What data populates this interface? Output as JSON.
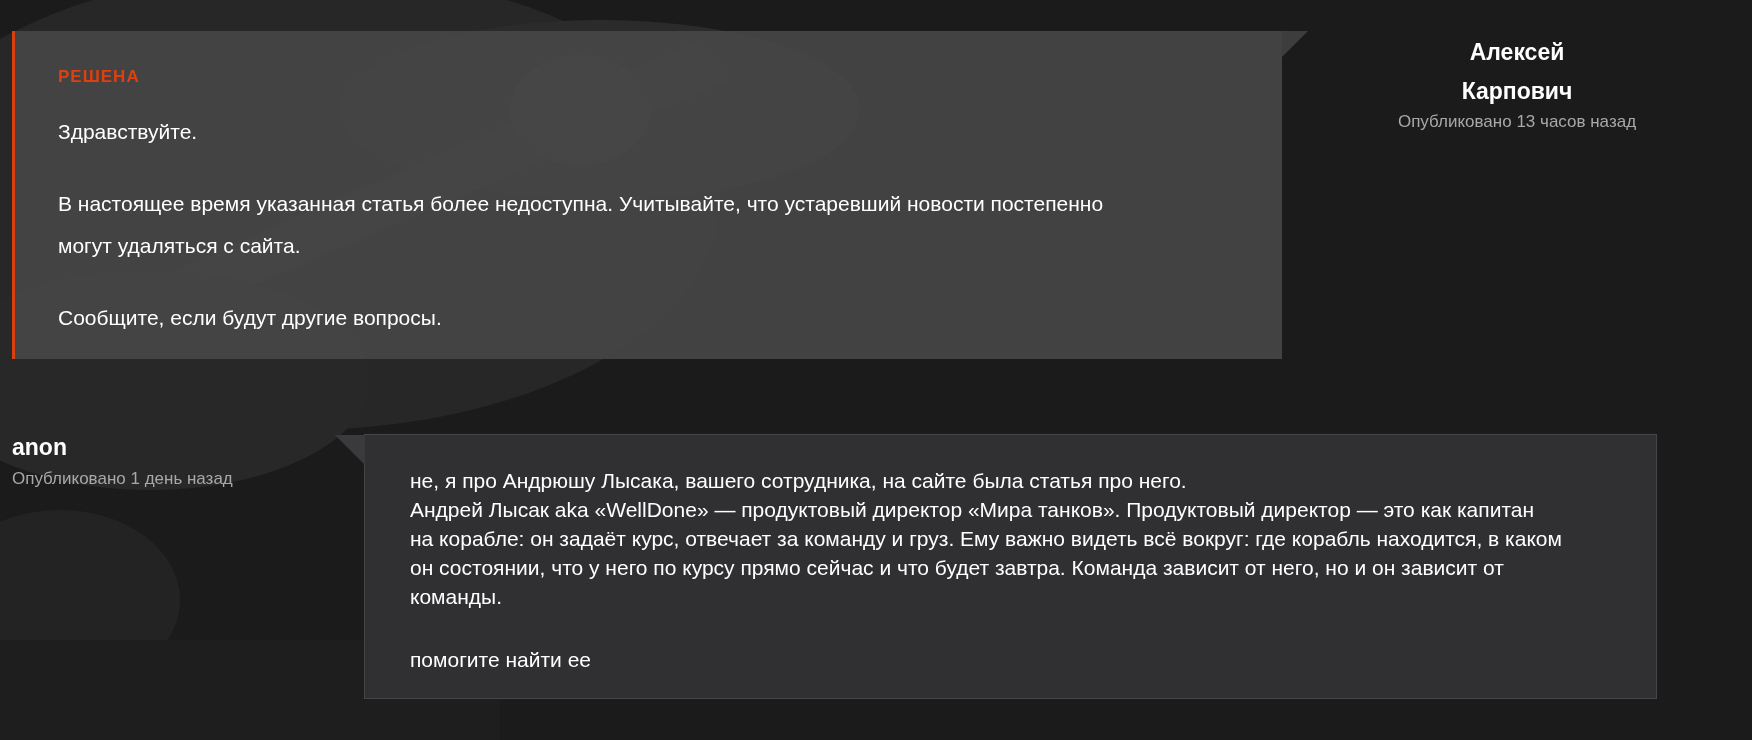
{
  "messages": [
    {
      "kind": "staff",
      "status": "РЕШЕНА",
      "paragraphs": [
        "Здравствуйте.",
        "В настоящее время указанная статья более недоступна. Учитывайте, что устаревший новости постепенно могут удаляться с сайта.",
        "Сообщите, если будут другие вопросы."
      ],
      "author": "Алексей Карпович",
      "published": "Опубликовано 13 часов назад"
    },
    {
      "kind": "user",
      "paragraphs": [
        "не, я про Андрюшу Лысака, вашего сотрудника, на сайте была статья про него.\nАндрей Лысак aka «WellDone» — продуктовый директор «Мира танков». Продуктовый директор — это как капитан на корабле: он задаёт курс, отвечает за команду и груз. Ему важно видеть всё вокруг: где корабль находится, в каком он состоянии, что у него по курсу прямо сейчас и что будет завтра. Команда зависит от него, но и он зависит от команды.",
        "помогите найти ее"
      ],
      "author": "anon",
      "published": "Опубликовано 1 день назад"
    }
  ]
}
